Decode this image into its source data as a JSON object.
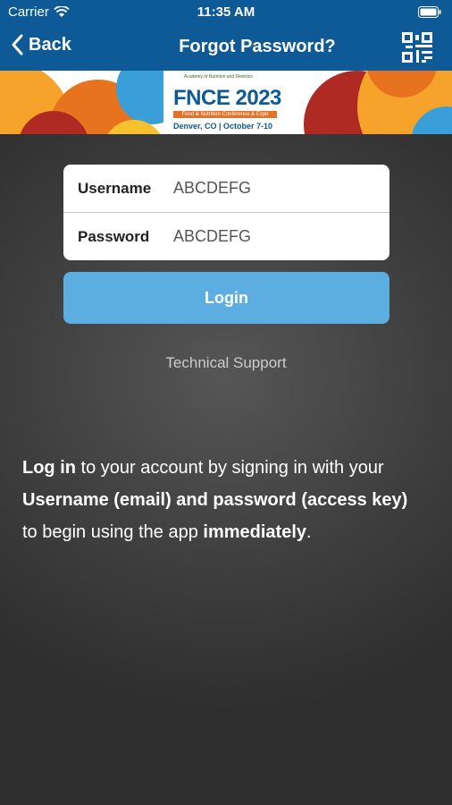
{
  "status": {
    "carrier": "Carrier",
    "time": "11:35 AM"
  },
  "nav": {
    "back_label": "Back",
    "title": "Forgot Password?"
  },
  "banner": {
    "org": "Academy of Nutrition and Dietetics",
    "brand": "FNCE 2023",
    "tagline": "Food & Nutrition Conference & Expo",
    "location": "Denver, CO | October 7-10"
  },
  "form": {
    "username_label": "Username",
    "username_value": "ABCDEFG",
    "password_label": "Password",
    "password_value": "ABCDEFG"
  },
  "login_label": "Login",
  "support_label": "Technical Support",
  "info": {
    "p1_bold": "Log in",
    "p1": " to your account by signing in with your ",
    "p2_bold": "Username (email) and password (access key)",
    "p2": " to begin using the app ",
    "p3_bold": "immediately",
    "p3": "."
  },
  "colors": {
    "header": "#0d5a96",
    "button": "#5daee0"
  }
}
